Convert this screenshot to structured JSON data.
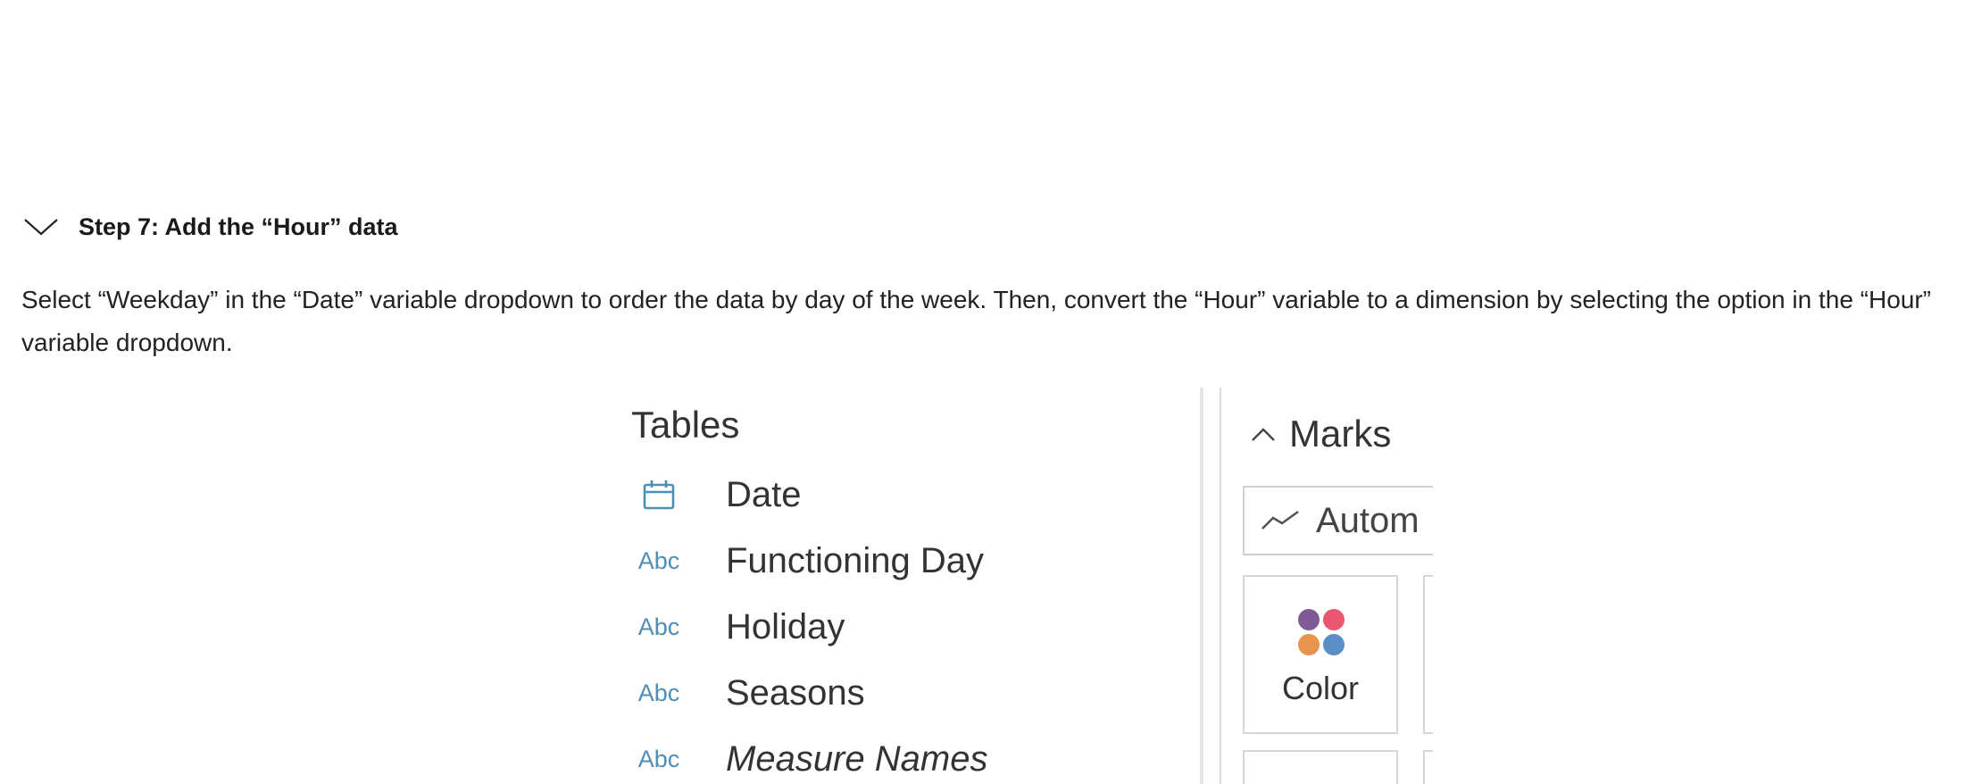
{
  "step": {
    "title": "Step 7: Add the “Hour” data",
    "description": "Select “Weekday” in the “Date” variable dropdown to order the data by day of the week. Then, convert the “Hour” variable to a dimension by selecting the option in the “Hour” variable dropdown."
  },
  "screenshot": {
    "tables_title": "Tables",
    "fields": [
      {
        "type_label": "",
        "icon": "calendar-icon",
        "name": "Date"
      },
      {
        "type_label": "Abc",
        "name": "Functioning Day"
      },
      {
        "type_label": "Abc",
        "name": "Holiday"
      },
      {
        "type_label": "Abc",
        "name": "Seasons"
      },
      {
        "type_label": "Abc",
        "name": "Measure Names"
      }
    ],
    "marks": {
      "title": "Marks",
      "mark_type": "Autom",
      "color_label": "Color"
    }
  },
  "colors": {
    "type_icon": "#4f8fb6",
    "dot_purple": "#7e5b97",
    "dot_red": "#e8576f",
    "dot_orange": "#e9944c",
    "dot_blue": "#5b8ec4"
  }
}
